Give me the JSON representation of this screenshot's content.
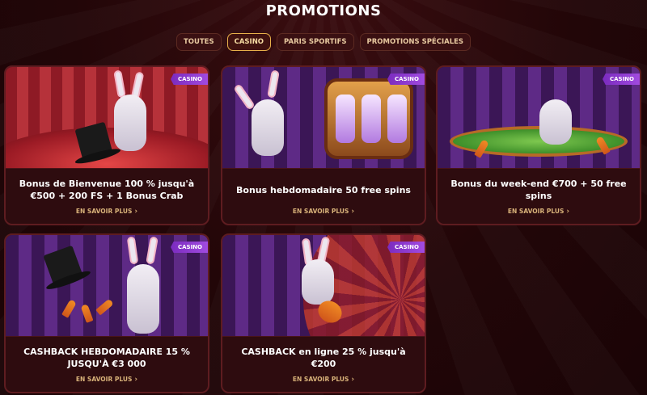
{
  "page": {
    "title": "PROMOTIONS"
  },
  "tabs": [
    {
      "label": "TOUTES",
      "active": false
    },
    {
      "label": "CASINO",
      "active": true
    },
    {
      "label": "PARIS SPORTIFS",
      "active": false
    },
    {
      "label": "PROMOTIONS SPÉCIALES",
      "active": false
    }
  ],
  "cards": [
    {
      "badge": "CASINO",
      "title": "Bonus de Bienvenue 100 % jusqu'à €500 + 200 FS + 1 Bonus Crab",
      "link": "EN SAVOIR PLUS"
    },
    {
      "badge": "CASINO",
      "title": "Bonus hebdomadaire 50 free spins",
      "link": "EN SAVOIR PLUS"
    },
    {
      "badge": "CASINO",
      "title": "Bonus du week-end €700 + 50 free spins",
      "link": "EN SAVOIR PLUS"
    },
    {
      "badge": "CASINO",
      "title": "CASHBACK HEBDOMADAIRE 15 % JUSQU'À €3 000",
      "link": "EN SAVOIR PLUS"
    },
    {
      "badge": "CASINO",
      "title": "CASHBACK en ligne 25 % jusqu'à €200",
      "link": "EN SAVOIR PLUS"
    }
  ],
  "colors": {
    "background": "#220608",
    "card": "#2e0c0f",
    "accent": "#e8b04a",
    "badge": "#8e36cf",
    "link": "#d9b37a"
  },
  "icons": {
    "link_arrow": "chevron-right-icon"
  }
}
